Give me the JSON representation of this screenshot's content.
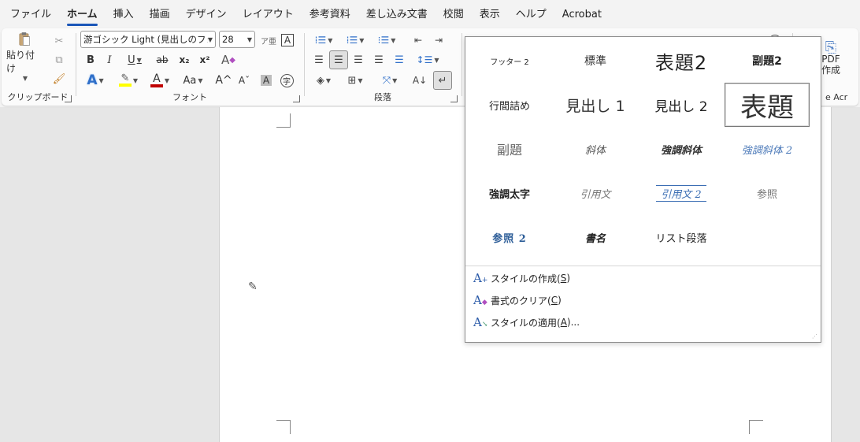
{
  "menubar": {
    "tabs": [
      "ファイル",
      "ホーム",
      "挿入",
      "描画",
      "デザイン",
      "レイアウト",
      "参考資料",
      "差し込み文書",
      "校閲",
      "表示",
      "ヘルプ",
      "Acrobat"
    ],
    "active_index": 1
  },
  "ribbon": {
    "clipboard": {
      "label": "クリップボード",
      "paste_label": "貼り付け"
    },
    "font": {
      "label": "フォント",
      "font_name": "游ゴシック Light (見出しのフォン",
      "font_size": "28",
      "bold": "B",
      "italic": "I",
      "underline": "U",
      "strike": "ab",
      "subscript": "x₂",
      "superscript": "x²",
      "change_case": "Aa",
      "grow": "A^",
      "shrink": "Aˇ",
      "shade": "A",
      "enclose": "字",
      "clear": "A",
      "font_color_hex": "#c00000",
      "highlight_hex": "#ffff00"
    },
    "paragraph": {
      "label": "段落"
    },
    "pdf": {
      "line1": "PDF",
      "line2": "作成",
      "partial": "e Acr"
    }
  },
  "gallery": {
    "styles": [
      [
        "フッター 2",
        "標準",
        "表題2",
        "副題2"
      ],
      [
        "行間詰め",
        "見出し 1",
        "見出し 2",
        "表題"
      ],
      [
        "副題",
        "斜体",
        "強調斜体",
        "強調斜体 2"
      ],
      [
        "強調太字",
        "引用文",
        "引用文 2",
        "参照"
      ],
      [
        "参照 2",
        "書名",
        "リスト段落"
      ]
    ],
    "commands": [
      {
        "pre": "スタイルの作成(",
        "key": "S",
        "post": ")"
      },
      {
        "pre": "書式のクリア(",
        "key": "C",
        "post": ")"
      },
      {
        "pre": "スタイルの適用(",
        "key": "A",
        "post": ")..."
      }
    ]
  },
  "colors": {
    "accent": "#1a56b8",
    "ribbon_bg": "#f3f3f3",
    "canvas_bg": "#e6e6e6"
  }
}
